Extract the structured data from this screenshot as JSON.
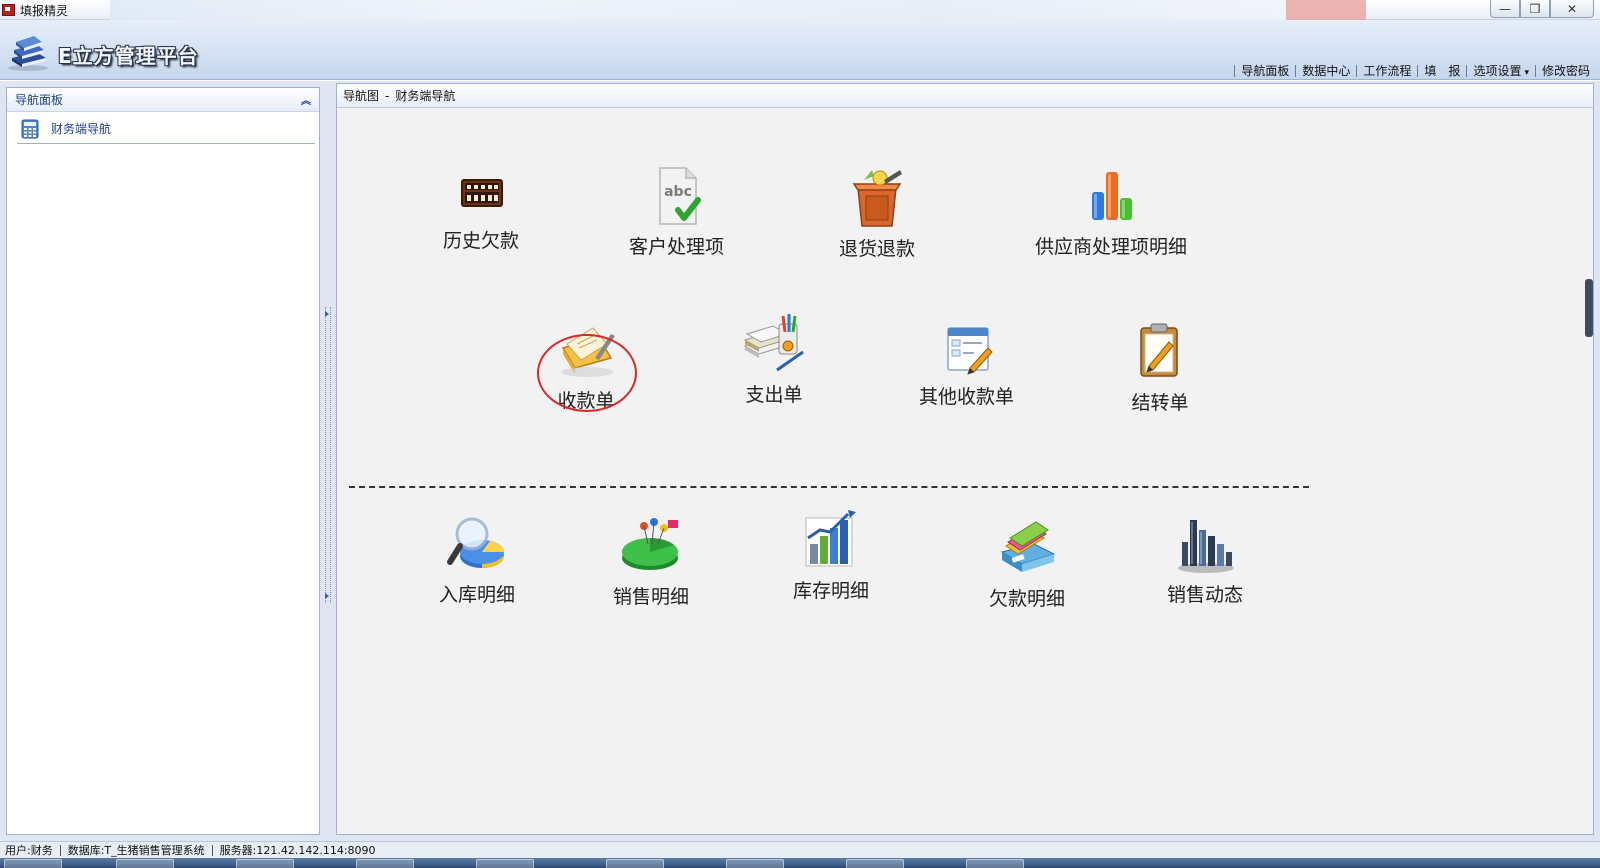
{
  "window": {
    "title": "填报精灵",
    "minimize": "—",
    "restore": "❐",
    "close": "✕"
  },
  "header": {
    "brand": "E立方管理平台",
    "nav": [
      {
        "label": "导航面板"
      },
      {
        "label": "数据中心"
      },
      {
        "label": "工作流程"
      },
      {
        "label": "填　报"
      },
      {
        "label": "选项设置",
        "dropdown": "▾"
      },
      {
        "label": "修改密码"
      }
    ]
  },
  "sidebar": {
    "title": "导航面板",
    "collapse_glyph": "︽",
    "items": [
      {
        "label": "财务端导航",
        "icon": "calculator-icon"
      }
    ]
  },
  "content": {
    "breadcrumb_root": "导航图",
    "breadcrumb_sep": "-",
    "breadcrumb_current": "财务端导航",
    "tiles": [
      {
        "label": "历史欠款",
        "icon": "abacus-icon"
      },
      {
        "label": "客户处理项",
        "icon": "spellcheck-document-icon"
      },
      {
        "label": "退货退款",
        "icon": "return-box-icon"
      },
      {
        "label": "供应商处理项明细",
        "icon": "bar-chart-icon"
      },
      {
        "label": "收款单",
        "icon": "folder-pen-icon",
        "highlighted": true
      },
      {
        "label": "支出单",
        "icon": "money-stack-icon"
      },
      {
        "label": "其他收款单",
        "icon": "form-edit-icon"
      },
      {
        "label": "结转单",
        "icon": "clipboard-pen-icon"
      },
      {
        "label": "入库明细",
        "icon": "magnifier-pie-icon"
      },
      {
        "label": "销售明细",
        "icon": "pie-chart-icon"
      },
      {
        "label": "库存明细",
        "icon": "growth-chart-icon"
      },
      {
        "label": "欠款明细",
        "icon": "file-drawer-icon"
      },
      {
        "label": "销售动态",
        "icon": "bar-graph-3d-icon"
      }
    ]
  },
  "status": {
    "user": "用户:财务",
    "database": "数据库:T_生猪销售管理系统",
    "server": "服务器:121.42.142.114:8090"
  },
  "colors": {
    "accent_blue": "#1f3f8a",
    "highlight_red": "#d82a2a",
    "header_gradient_top": "#e7eef9",
    "header_gradient_bottom": "#c5d6ee"
  }
}
